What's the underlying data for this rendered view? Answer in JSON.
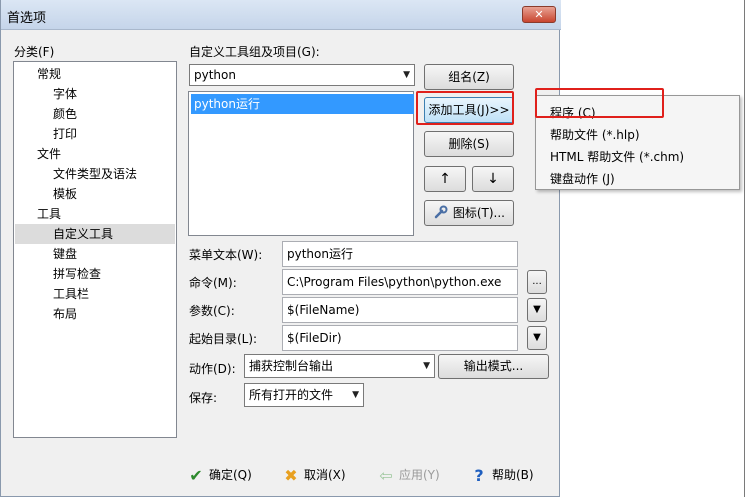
{
  "window": {
    "title": "首选项",
    "close_symbol": "✕"
  },
  "left_panel": {
    "label": "分类(F)",
    "tree": [
      {
        "label": "常规",
        "level": 1
      },
      {
        "label": "字体",
        "level": 2
      },
      {
        "label": "颜色",
        "level": 2
      },
      {
        "label": "打印",
        "level": 2
      },
      {
        "label": "文件",
        "level": 1
      },
      {
        "label": "文件类型及语法",
        "level": 2
      },
      {
        "label": "模板",
        "level": 2
      },
      {
        "label": "工具",
        "level": 1
      },
      {
        "label": "自定义工具",
        "level": 2,
        "selected": true
      },
      {
        "label": "键盘",
        "level": 2
      },
      {
        "label": "拼写检查",
        "level": 2
      },
      {
        "label": "工具栏",
        "level": 2
      },
      {
        "label": "布局",
        "level": 2
      }
    ]
  },
  "tool_group": {
    "label": "自定义工具组及项目(G):",
    "selected_group": "python",
    "items": [
      "python运行"
    ]
  },
  "buttons": {
    "group_name": "组名(Z)",
    "add_tool": "添加工具(J)>>",
    "delete": "删除(S)",
    "move_up": "↑",
    "move_down": "↓",
    "icon": "图标(T)..."
  },
  "add_tool_menu": [
    {
      "label": "程序 (C)"
    },
    {
      "label": "帮助文件 (*.hlp)"
    },
    {
      "label": "HTML 帮助文件 (*.chm)"
    },
    {
      "label": "键盘动作 (J)"
    }
  ],
  "form": {
    "menu_text_label": "菜单文本(W):",
    "menu_text_value": "python运行",
    "command_label": "命令(M):",
    "command_value": "C:\\Program Files\\python\\python.exe",
    "browse_label": "...",
    "args_label": "参数(C):",
    "args_value": "$(FileName)",
    "start_dir_label": "起始目录(L):",
    "start_dir_value": "$(FileDir)",
    "action_label": "动作(D):",
    "action_value": "捕获控制台输出",
    "output_mode_label": "输出模式...",
    "save_label": "保存:",
    "save_value": "所有打开的文件"
  },
  "footer": {
    "ok": "确定(Q)",
    "cancel": "取消(X)",
    "apply": "应用(Y)",
    "help": "帮助(B)"
  },
  "colors": {
    "highlight_red": "#e0201b",
    "selection_blue": "#3399ff",
    "ok_green": "#2d8a2d",
    "cancel_orange": "#e8a020",
    "help_blue": "#1f5fbf"
  }
}
